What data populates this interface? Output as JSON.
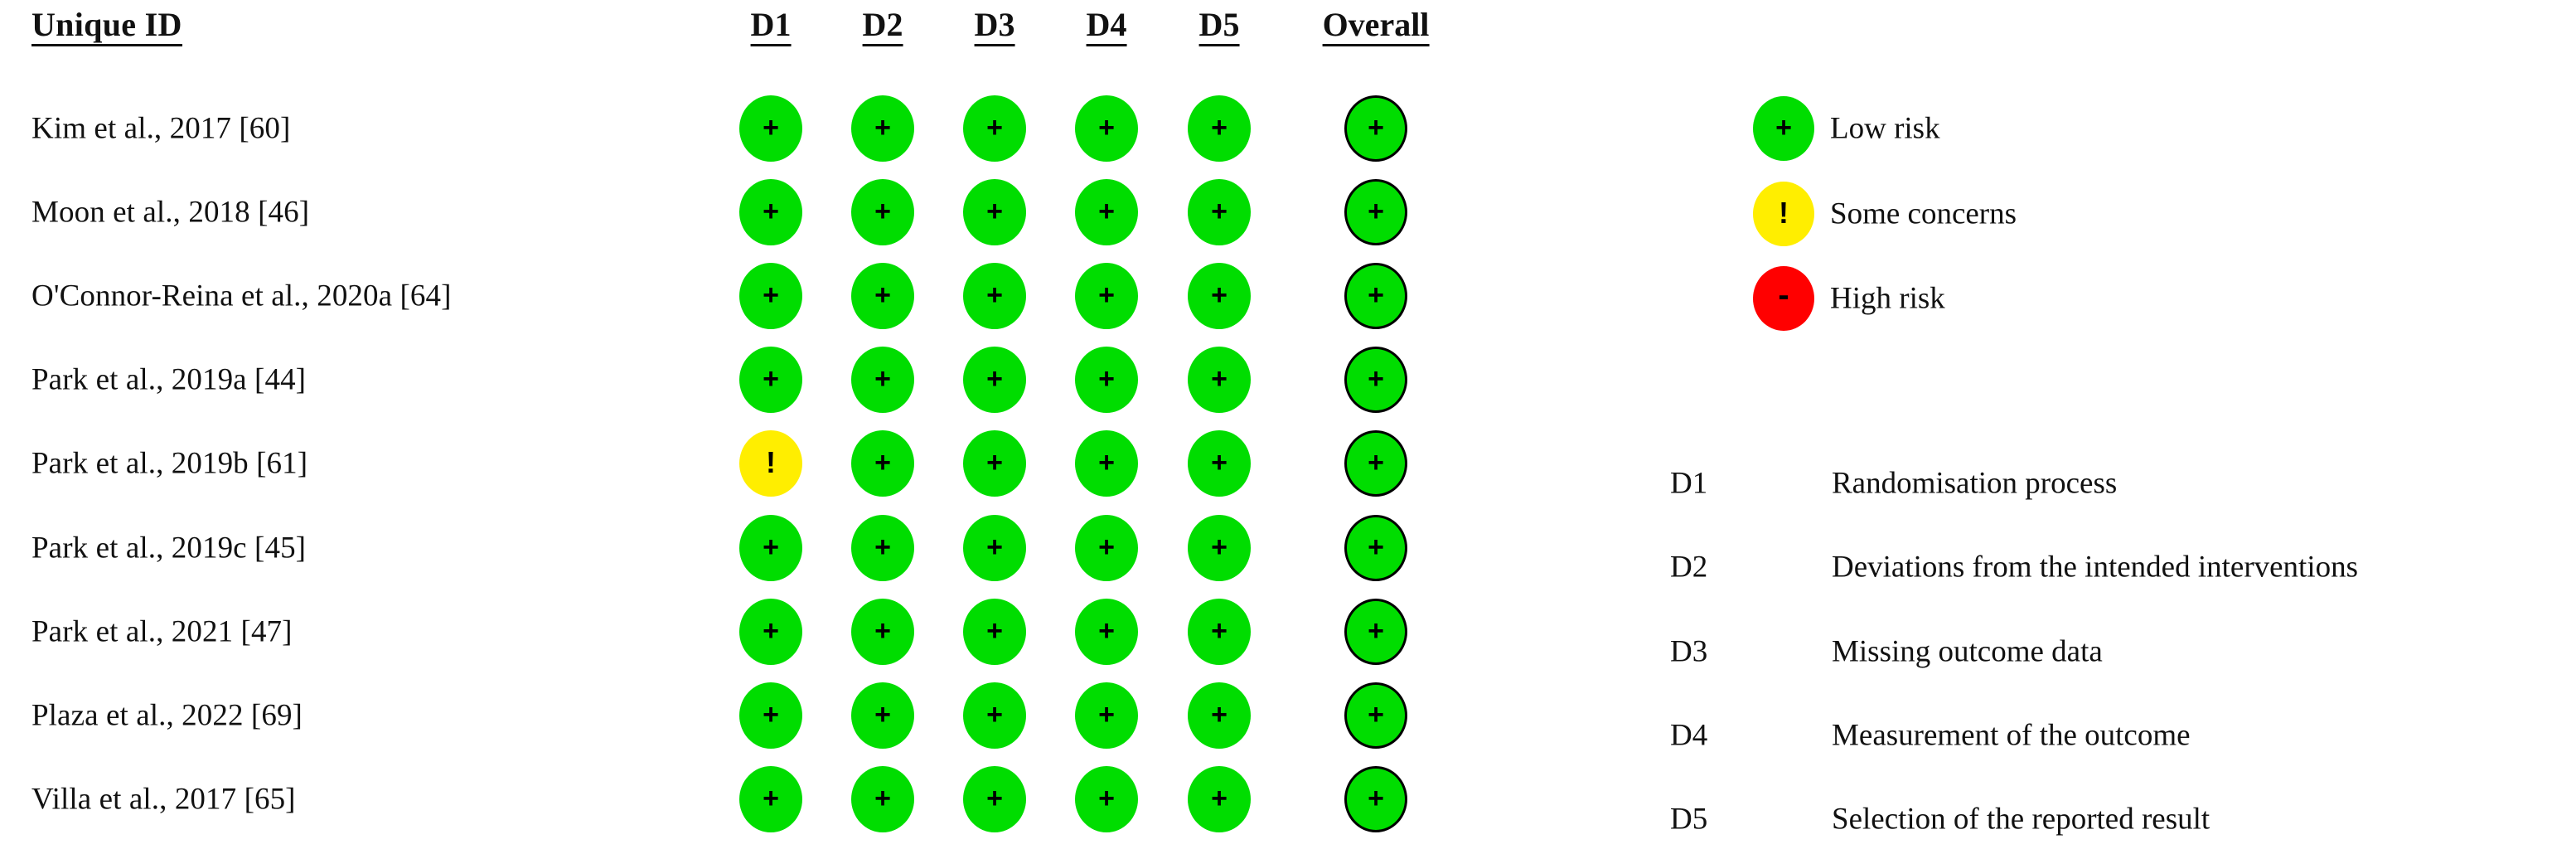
{
  "table": {
    "id_header": "Unique ID",
    "domain_headers": [
      "D1",
      "D2",
      "D3",
      "D4",
      "D5",
      "Overall"
    ],
    "rows": [
      {
        "study": "Kim et al., 2017 [60]",
        "judgements": [
          "low",
          "low",
          "low",
          "low",
          "low",
          "low"
        ]
      },
      {
        "study": "Moon et al., 2018 [46]",
        "judgements": [
          "low",
          "low",
          "low",
          "low",
          "low",
          "low"
        ]
      },
      {
        "study": "O'Connor-Reina et al., 2020a [64]",
        "judgements": [
          "low",
          "low",
          "low",
          "low",
          "low",
          "low"
        ]
      },
      {
        "study": "Park et al., 2019a [44]",
        "judgements": [
          "low",
          "low",
          "low",
          "low",
          "low",
          "low"
        ]
      },
      {
        "study": "Park et al., 2019b [61]",
        "judgements": [
          "some",
          "low",
          "low",
          "low",
          "low",
          "low"
        ]
      },
      {
        "study": "Park et al., 2019c  [45]",
        "judgements": [
          "low",
          "low",
          "low",
          "low",
          "low",
          "low"
        ]
      },
      {
        "study": "Park et al., 2021 [47]",
        "judgements": [
          "low",
          "low",
          "low",
          "low",
          "low",
          "low"
        ]
      },
      {
        "study": "Plaza et al., 2022 [69]",
        "judgements": [
          "low",
          "low",
          "low",
          "low",
          "low",
          "low"
        ]
      },
      {
        "study": "Villa et al., 2017 [65]",
        "judgements": [
          "low",
          "low",
          "low",
          "low",
          "low",
          "low"
        ]
      }
    ]
  },
  "legend": {
    "items": [
      {
        "key": "low",
        "label": "Low risk",
        "glyph": "+",
        "color": "#00dd00"
      },
      {
        "key": "some",
        "label": "Some concerns",
        "glyph": "!",
        "color": "#ffee00"
      },
      {
        "key": "high",
        "label": "High risk",
        "glyph": "-",
        "color": "#ff0000"
      }
    ]
  },
  "domain_key": {
    "items": [
      {
        "code": "D1",
        "description": "Randomisation process"
      },
      {
        "code": "D2",
        "description": "Deviations from the intended interventions"
      },
      {
        "code": "D3",
        "description": "Missing outcome data"
      },
      {
        "code": "D4",
        "description": "Measurement of the outcome"
      },
      {
        "code": "D5",
        "description": "Selection of the reported result"
      }
    ]
  }
}
